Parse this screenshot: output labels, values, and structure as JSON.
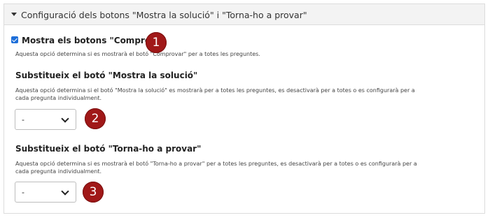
{
  "section": {
    "title": "Configuració dels botons \"Mostra la solució\" i \"Torna-ho a provar\""
  },
  "show_check": {
    "label": "Mostra els botons \"Comprova\"",
    "checked": true,
    "description": "Aquesta opció determina si es mostrarà el botó \"Comprovar\" per a totes les preguntes."
  },
  "override_solution": {
    "heading": "Substitueix el botó \"Mostra la solució\"",
    "description_line1": "Aquesta opció determina si el botó \"Mostra la solució\" es mostrarà per a totes les preguntes, es desactivarà per a totes o es configurarà per a",
    "description_line2": "cada pregunta individualment.",
    "selected": "-"
  },
  "override_retry": {
    "heading": "Substitueix el botó \"Torna-ho a provar\"",
    "description_line1": "Aquesta opció determina si es mostrarà el botó \"Torna-ho a provar\" per a totes les preguntes, es desactivarà per a totes o es configurarà per a",
    "description_line2": "cada pregunta individualment.",
    "selected": "-"
  },
  "markers": [
    "1",
    "2",
    "3"
  ]
}
